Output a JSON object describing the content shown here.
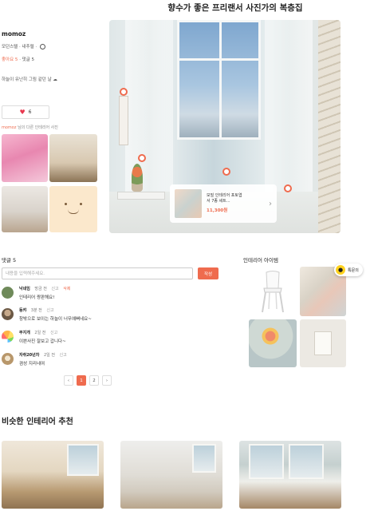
{
  "page": {
    "title": "향수가 좋은 프리랜서 사진가의 복층집"
  },
  "author": {
    "name": "momoz",
    "style_line": "모던스텔 · 내추럴 · ",
    "likes": "좋아요 5",
    "comments": "· 댓글 5",
    "caption": "하늘이 유난히 그림 같던 날 ☁"
  },
  "like_button": {
    "icon": "heart-icon",
    "count": "6"
  },
  "other_photos": {
    "user": "momoz",
    "label": " 님의 다른 인테리어 사진"
  },
  "product_card": {
    "name_line1": "모빌 인테리어 포토엽",
    "name_line2": "서 7종 세트...",
    "price": "11,300원"
  },
  "comments": {
    "header": "댓글 5",
    "input_placeholder": "내용을 입력해주세요.",
    "submit_label": "작성",
    "items": [
      {
        "nick": "낙네임",
        "time": "방금 전",
        "report": "신고",
        "delete": "삭제",
        "text": "인테리어 짱판해요!",
        "avatar_color": "#6f8a5a"
      },
      {
        "nick": "등캬",
        "time": "3분 전",
        "report": "신고",
        "delete": "",
        "text": "창밖으로 보이는 하늘이 너무예뻐네요~",
        "avatar_color": "#7c6a55"
      },
      {
        "nick": "무지개",
        "time": "2일 전",
        "report": "신고",
        "delete": "",
        "text": "이쁜사진 잘보고 갑니다~",
        "avatar_color": "#ffffff"
      },
      {
        "nick": "자취20년차",
        "time": "2일 전",
        "report": "신고",
        "delete": "",
        "text": "겸성 지리네여",
        "avatar_color": "#c9b08a"
      }
    ]
  },
  "pagination": {
    "prev": "‹",
    "pages": [
      "1",
      "2"
    ],
    "active": "1",
    "next": "›"
  },
  "interior_items": {
    "header": "인테리어 아이템",
    "chat_label": "톡문의",
    "chat_icon": "chat-icon"
  },
  "similar": {
    "title": "비슷한 인테리어 추천"
  },
  "colors": {
    "accent": "#ef6b4e",
    "heart": "#e8384f",
    "chat": "#ffd21f"
  }
}
